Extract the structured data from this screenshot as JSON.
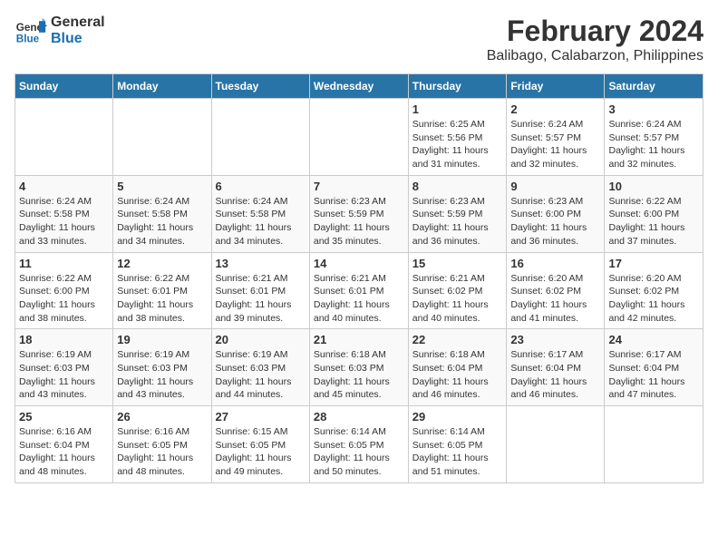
{
  "logo": {
    "line1": "General",
    "line2": "Blue"
  },
  "title": "February 2024",
  "subtitle": "Balibago, Calabarzon, Philippines",
  "days_of_week": [
    "Sunday",
    "Monday",
    "Tuesday",
    "Wednesday",
    "Thursday",
    "Friday",
    "Saturday"
  ],
  "weeks": [
    [
      {
        "day": "",
        "info": ""
      },
      {
        "day": "",
        "info": ""
      },
      {
        "day": "",
        "info": ""
      },
      {
        "day": "",
        "info": ""
      },
      {
        "day": "1",
        "info": "Sunrise: 6:25 AM\nSunset: 5:56 PM\nDaylight: 11 hours and 31 minutes."
      },
      {
        "day": "2",
        "info": "Sunrise: 6:24 AM\nSunset: 5:57 PM\nDaylight: 11 hours and 32 minutes."
      },
      {
        "day": "3",
        "info": "Sunrise: 6:24 AM\nSunset: 5:57 PM\nDaylight: 11 hours and 32 minutes."
      }
    ],
    [
      {
        "day": "4",
        "info": "Sunrise: 6:24 AM\nSunset: 5:58 PM\nDaylight: 11 hours and 33 minutes."
      },
      {
        "day": "5",
        "info": "Sunrise: 6:24 AM\nSunset: 5:58 PM\nDaylight: 11 hours and 34 minutes."
      },
      {
        "day": "6",
        "info": "Sunrise: 6:24 AM\nSunset: 5:58 PM\nDaylight: 11 hours and 34 minutes."
      },
      {
        "day": "7",
        "info": "Sunrise: 6:23 AM\nSunset: 5:59 PM\nDaylight: 11 hours and 35 minutes."
      },
      {
        "day": "8",
        "info": "Sunrise: 6:23 AM\nSunset: 5:59 PM\nDaylight: 11 hours and 36 minutes."
      },
      {
        "day": "9",
        "info": "Sunrise: 6:23 AM\nSunset: 6:00 PM\nDaylight: 11 hours and 36 minutes."
      },
      {
        "day": "10",
        "info": "Sunrise: 6:22 AM\nSunset: 6:00 PM\nDaylight: 11 hours and 37 minutes."
      }
    ],
    [
      {
        "day": "11",
        "info": "Sunrise: 6:22 AM\nSunset: 6:00 PM\nDaylight: 11 hours and 38 minutes."
      },
      {
        "day": "12",
        "info": "Sunrise: 6:22 AM\nSunset: 6:01 PM\nDaylight: 11 hours and 38 minutes."
      },
      {
        "day": "13",
        "info": "Sunrise: 6:21 AM\nSunset: 6:01 PM\nDaylight: 11 hours and 39 minutes."
      },
      {
        "day": "14",
        "info": "Sunrise: 6:21 AM\nSunset: 6:01 PM\nDaylight: 11 hours and 40 minutes."
      },
      {
        "day": "15",
        "info": "Sunrise: 6:21 AM\nSunset: 6:02 PM\nDaylight: 11 hours and 40 minutes."
      },
      {
        "day": "16",
        "info": "Sunrise: 6:20 AM\nSunset: 6:02 PM\nDaylight: 11 hours and 41 minutes."
      },
      {
        "day": "17",
        "info": "Sunrise: 6:20 AM\nSunset: 6:02 PM\nDaylight: 11 hours and 42 minutes."
      }
    ],
    [
      {
        "day": "18",
        "info": "Sunrise: 6:19 AM\nSunset: 6:03 PM\nDaylight: 11 hours and 43 minutes."
      },
      {
        "day": "19",
        "info": "Sunrise: 6:19 AM\nSunset: 6:03 PM\nDaylight: 11 hours and 43 minutes."
      },
      {
        "day": "20",
        "info": "Sunrise: 6:19 AM\nSunset: 6:03 PM\nDaylight: 11 hours and 44 minutes."
      },
      {
        "day": "21",
        "info": "Sunrise: 6:18 AM\nSunset: 6:03 PM\nDaylight: 11 hours and 45 minutes."
      },
      {
        "day": "22",
        "info": "Sunrise: 6:18 AM\nSunset: 6:04 PM\nDaylight: 11 hours and 46 minutes."
      },
      {
        "day": "23",
        "info": "Sunrise: 6:17 AM\nSunset: 6:04 PM\nDaylight: 11 hours and 46 minutes."
      },
      {
        "day": "24",
        "info": "Sunrise: 6:17 AM\nSunset: 6:04 PM\nDaylight: 11 hours and 47 minutes."
      }
    ],
    [
      {
        "day": "25",
        "info": "Sunrise: 6:16 AM\nSunset: 6:04 PM\nDaylight: 11 hours and 48 minutes."
      },
      {
        "day": "26",
        "info": "Sunrise: 6:16 AM\nSunset: 6:05 PM\nDaylight: 11 hours and 48 minutes."
      },
      {
        "day": "27",
        "info": "Sunrise: 6:15 AM\nSunset: 6:05 PM\nDaylight: 11 hours and 49 minutes."
      },
      {
        "day": "28",
        "info": "Sunrise: 6:14 AM\nSunset: 6:05 PM\nDaylight: 11 hours and 50 minutes."
      },
      {
        "day": "29",
        "info": "Sunrise: 6:14 AM\nSunset: 6:05 PM\nDaylight: 11 hours and 51 minutes."
      },
      {
        "day": "",
        "info": ""
      },
      {
        "day": "",
        "info": ""
      }
    ]
  ]
}
